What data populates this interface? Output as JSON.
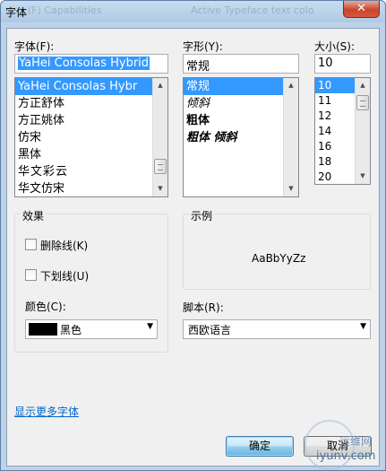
{
  "window": {
    "title": "字体",
    "ghost_left": "(F)  Capabilities",
    "ghost_right": "Active Typeface text colo"
  },
  "font_face": {
    "label": "字体(F):",
    "value": "YaHei Consolas Hybrid",
    "items": [
      "YaHei Consolas Hybr",
      "方正舒体",
      "方正姚体",
      "仿宋",
      "黑体",
      "华文彩云",
      "华文仿宋"
    ]
  },
  "font_style": {
    "label": "字形(Y):",
    "value": "常规",
    "items": [
      "常规",
      "倾斜",
      "粗体",
      "粗体 倾斜"
    ]
  },
  "font_size": {
    "label": "大小(S):",
    "value": "10",
    "items": [
      "10",
      "11",
      "12",
      "14",
      "16",
      "18",
      "20"
    ]
  },
  "effects": {
    "title": "效果",
    "strikeout_label": "删除线(K)",
    "underline_label": "下划线(U)",
    "color_label": "颜色(C):",
    "color_value": "黑色",
    "color_swatch": "#000000"
  },
  "sample": {
    "title": "示例",
    "text": "AaBbYyZz"
  },
  "script": {
    "label": "脚本(R):",
    "value": "西欧语言"
  },
  "more_fonts_link": "显示更多字体",
  "buttons": {
    "ok": "确定",
    "cancel": "取消"
  },
  "watermark": {
    "text": "iyunv.com",
    "brand": "运维网"
  },
  "icons": {
    "close": "close-icon",
    "dropdown": "chevron-down-icon",
    "scroll_up": "chevron-up-icon",
    "scroll_down": "chevron-down-icon"
  }
}
